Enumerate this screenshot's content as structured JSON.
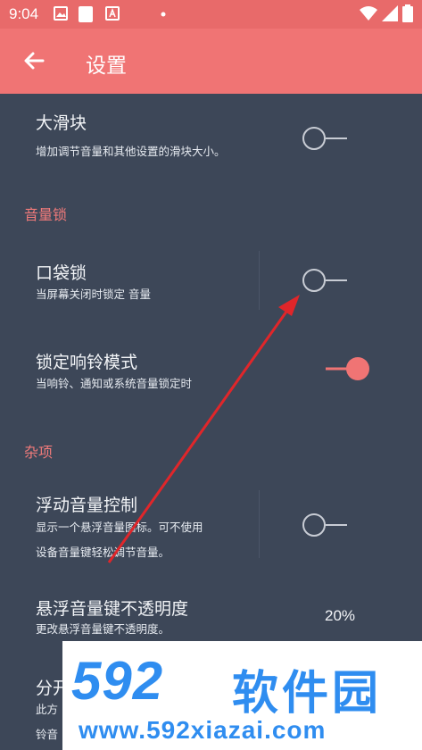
{
  "status": {
    "time": "9:04"
  },
  "appbar": {
    "title": "设置"
  },
  "items": {
    "big_slider": {
      "title": "大滑块",
      "summary": "增加调节音量和其他设置的滑块大小。",
      "enabled": false
    },
    "pocket_lock": {
      "title": "口袋锁",
      "summary": "当屏幕关闭时锁定 音量",
      "enabled": false
    },
    "ringer_lock": {
      "title": "锁定响铃模式",
      "summary": "当响铃、通知或系统音量锁定时",
      "enabled": true
    },
    "floating": {
      "title": "浮动音量控制",
      "summary_line1": "显示一个悬浮音量图标。可不使用",
      "summary_line2": "设备音量键轻松调节音量。",
      "enabled": false
    },
    "opacity": {
      "title": "悬浮音量键不透明度",
      "summary": "更改悬浮音量键不透明度。",
      "value": "20%"
    },
    "split": {
      "title": "分开",
      "summary_line1": "此方",
      "summary_line2": "铃音"
    }
  },
  "categories": {
    "volume_lock": "音量锁",
    "misc": "杂项"
  },
  "watermark": {
    "main": "592",
    "cn": "软件园",
    "url": "www.592xiazai.com"
  },
  "colors": {
    "accent": "#f07474",
    "background": "#3d4758",
    "watermark": "#2f8df0"
  }
}
